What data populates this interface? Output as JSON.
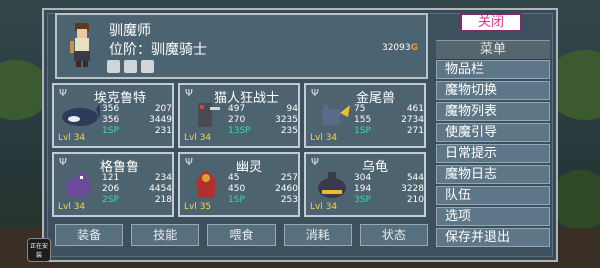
{
  "tamer": {
    "name": "驯魔师",
    "rank": "位阶：驯魔骑士",
    "gold": "32093",
    "gold_icon": "G"
  },
  "close_label": "关闭",
  "menu": {
    "header": "菜单",
    "items": [
      "物品栏",
      "魔物切换",
      "魔物列表",
      "使魔引导",
      "日常提示",
      "魔物日志",
      "队伍",
      "选项",
      "保存并退出"
    ]
  },
  "monsters": [
    {
      "name": "埃克鲁特",
      "atk": "356",
      "def": "207",
      "mp": "356",
      "hp": "3449",
      "sp": "1SP",
      "sub": "231",
      "level": "Lvl 34",
      "sprite_color": "#2d3a5a"
    },
    {
      "name": "猫人狂战士",
      "atk": "497",
      "def": "94",
      "mp": "270",
      "hp": "3235",
      "sp": "13SP",
      "sub": "235",
      "level": "Lvl 34",
      "sprite_color": "#4a4a52"
    },
    {
      "name": "金尾兽",
      "atk": "75",
      "def": "461",
      "mp": "155",
      "hp": "2734",
      "sp": "1SP",
      "sub": "271",
      "level": "Lvl 34",
      "sprite_color": "#5a6a8a"
    },
    {
      "name": "格鲁鲁",
      "atk": "121",
      "def": "234",
      "mp": "206",
      "hp": "4454",
      "sp": "2SP",
      "sub": "218",
      "level": "Lvl 34",
      "sprite_color": "#6b4a9a"
    },
    {
      "name": "幽灵",
      "atk": "45",
      "def": "257",
      "mp": "450",
      "hp": "2460",
      "sp": "1SP",
      "sub": "253",
      "level": "Lvl 35",
      "sprite_color": "#b03030"
    },
    {
      "name": "乌龟",
      "atk": "304",
      "def": "544",
      "mp": "194",
      "hp": "3228",
      "sp": "3SP",
      "sub": "210",
      "level": "Lvl 34",
      "sprite_color": "#3a3a4a"
    }
  ],
  "tabs": [
    "装备",
    "技能",
    "喂食",
    "消耗",
    "状态"
  ],
  "app_icon_label": "正在安装"
}
